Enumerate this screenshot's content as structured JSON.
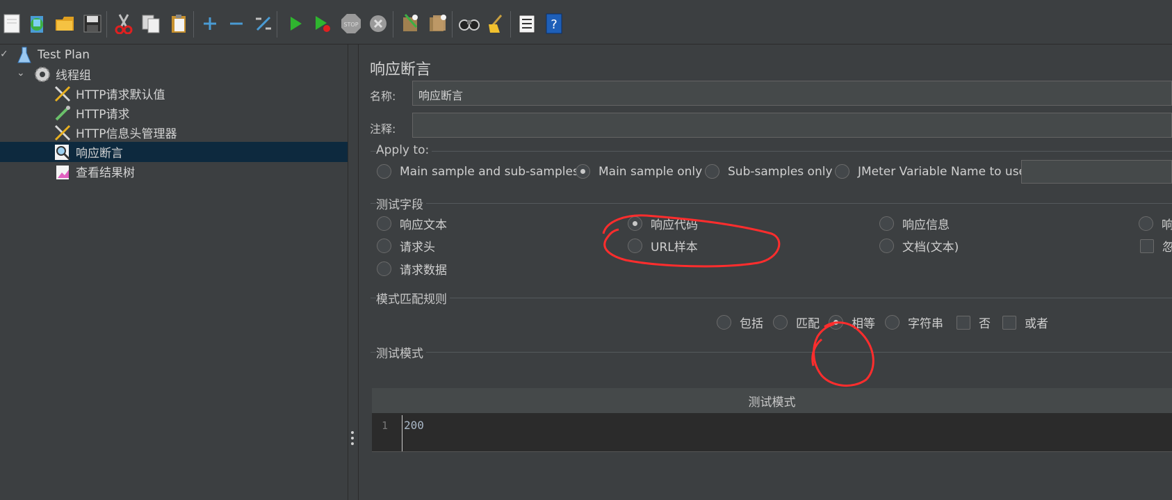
{
  "tree": {
    "items": [
      {
        "label": "Test Plan"
      },
      {
        "label": "线程组"
      },
      {
        "label": "HTTP请求默认值"
      },
      {
        "label": "HTTP请求"
      },
      {
        "label": "HTTP信息头管理器"
      },
      {
        "label": "响应断言"
      },
      {
        "label": "查看结果树"
      }
    ],
    "selected": "响应断言"
  },
  "toolbar": {
    "icons": [
      "new-icon",
      "templates-icon",
      "open-icon",
      "save-icon",
      "cut-icon",
      "copy-icon",
      "paste-icon",
      "expand-icon",
      "collapse-icon",
      "toggle-icon",
      "start-icon",
      "start-no-pauses-icon",
      "stop-icon",
      "shutdown-icon",
      "clear-icon",
      "clear-all-icon",
      "search-icon",
      "reset-search-icon",
      "function-helper-icon",
      "help-icon"
    ]
  },
  "panel": {
    "title": "响应断言",
    "name_label": "名称:",
    "name_value": "响应断言",
    "comment_label": "注释:",
    "comment_value": "",
    "apply_to": {
      "legend": "Apply to:",
      "options": [
        "Main sample and sub-samples",
        "Main sample only",
        "Sub-samples only",
        "JMeter Variable Name to use"
      ],
      "selected": "Main sample only"
    },
    "test_field": {
      "legend": "测试字段",
      "options": [
        "响应文本",
        "响应代码",
        "响应信息",
        "响",
        "请求头",
        "URL样本",
        "文档(文本)",
        "请求数据"
      ],
      "checkbox_partial": "忽",
      "selected": "响应代码"
    },
    "pattern_rules": {
      "legend": "模式匹配规则",
      "options": [
        "包括",
        "匹配",
        "相等",
        "字符串"
      ],
      "checkboxes": [
        "否",
        "或者"
      ],
      "selected": "相等"
    },
    "patterns": {
      "legend": "测试模式",
      "column_header": "测试模式",
      "line_number": "1",
      "value": "200"
    }
  },
  "colors": {
    "background": "#3c3f41",
    "selection": "#0d293e",
    "annotation": "#ff2d2d"
  }
}
